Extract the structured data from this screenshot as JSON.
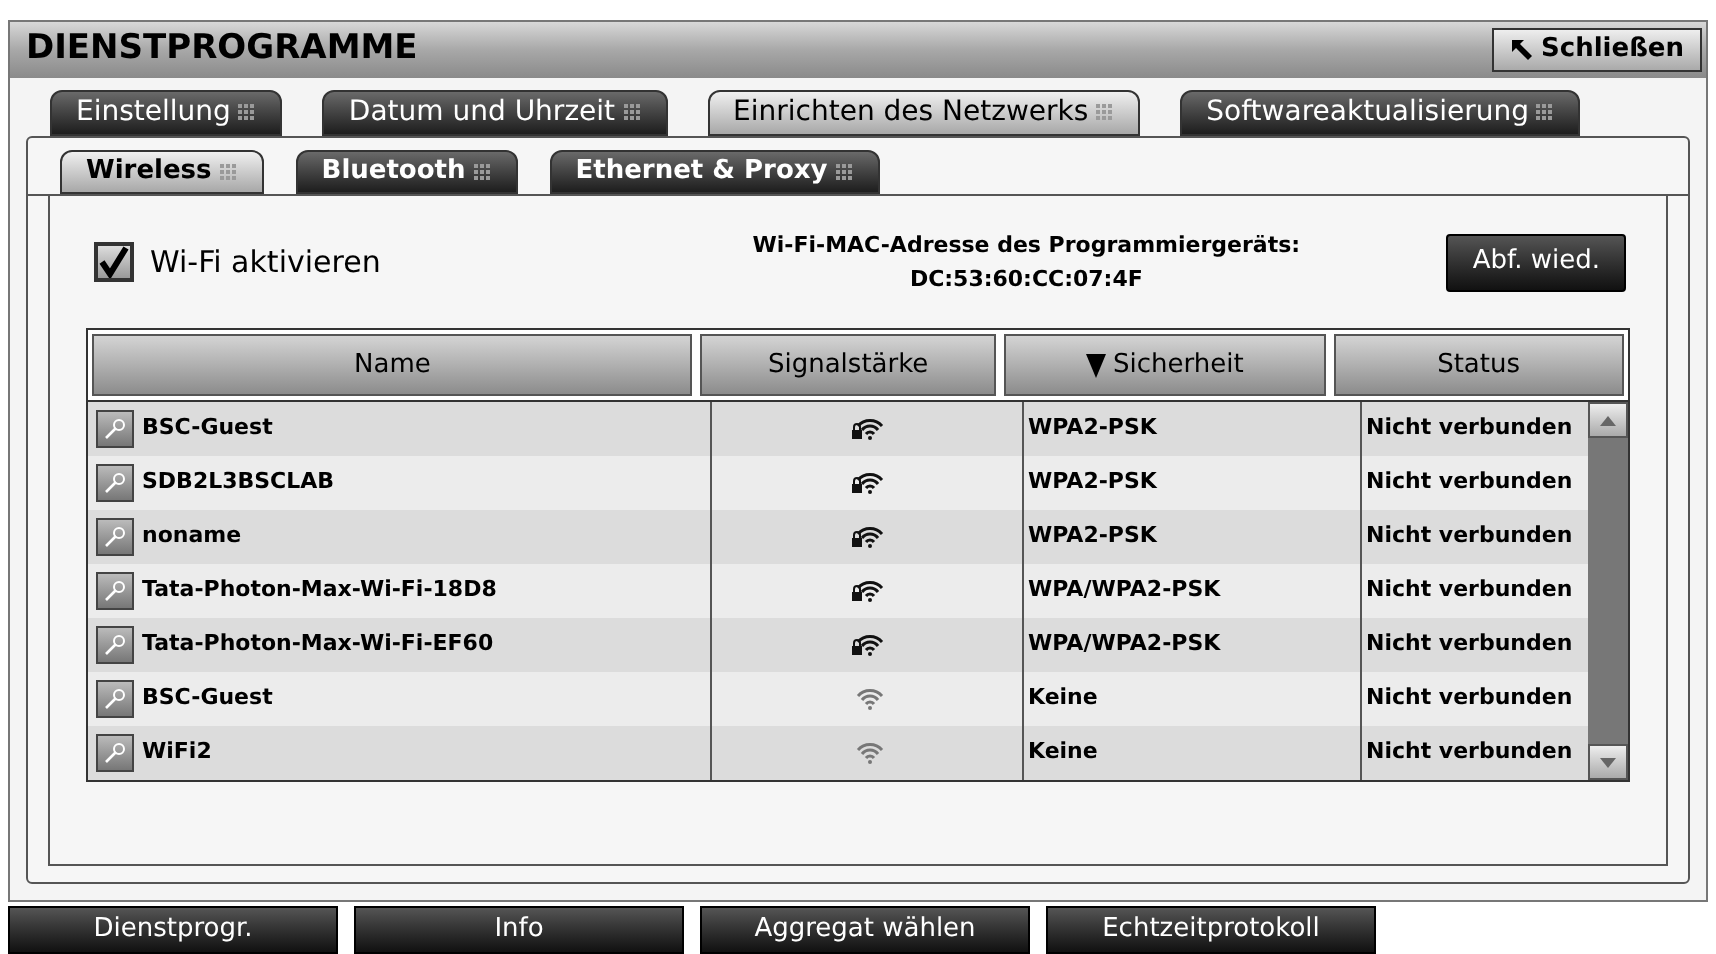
{
  "window": {
    "title": "DIENSTPROGRAMME",
    "close_button": "Schließen"
  },
  "tabs": [
    {
      "label": "Einstellung",
      "selected": false
    },
    {
      "label": "Datum und Uhrzeit",
      "selected": false
    },
    {
      "label": "Einrichten des Netzwerks",
      "selected": true
    },
    {
      "label": "Softwareaktualisierung",
      "selected": false
    }
  ],
  "subtabs": [
    {
      "label": "Wireless",
      "selected": true
    },
    {
      "label": "Bluetooth",
      "selected": false
    },
    {
      "label": "Ethernet & Proxy",
      "selected": false
    }
  ],
  "wifi_enable": {
    "label": "Wi-Fi aktivieren",
    "checked": true
  },
  "mac": {
    "label": "Wi-Fi-MAC-Adresse des Programmiergeräts:",
    "value": "DC:53:60:CC:07:4F"
  },
  "rescan_button": "Abf. wied.",
  "table": {
    "columns": [
      {
        "label": "Name",
        "sorted": false
      },
      {
        "label": "Signalstärke",
        "sorted": false
      },
      {
        "label": "Sicherheit",
        "sorted": true
      },
      {
        "label": "Status",
        "sorted": false
      }
    ],
    "rows": [
      {
        "name": "BSC-Guest",
        "locked": true,
        "security": "WPA2-PSK",
        "status": "Nicht verbunden"
      },
      {
        "name": "SDB2L3BSCLAB",
        "locked": true,
        "security": "WPA2-PSK",
        "status": "Nicht verbunden"
      },
      {
        "name": "noname",
        "locked": true,
        "security": "WPA2-PSK",
        "status": "Nicht verbunden"
      },
      {
        "name": "Tata-Photon-Max-Wi-Fi-18D8",
        "locked": true,
        "security": "WPA/WPA2-PSK",
        "status": "Nicht verbunden"
      },
      {
        "name": "Tata-Photon-Max-Wi-Fi-EF60",
        "locked": true,
        "security": "WPA/WPA2-PSK",
        "status": "Nicht verbunden"
      },
      {
        "name": "BSC-Guest",
        "locked": false,
        "security": "Keine",
        "status": "Nicht verbunden"
      },
      {
        "name": "WiFi2",
        "locked": false,
        "security": "Keine",
        "status": "Nicht verbunden"
      }
    ]
  },
  "bottom_buttons": [
    "Dienstprogr.",
    "Info",
    "Aggregat wählen",
    "Echtzeitprotokoll"
  ]
}
